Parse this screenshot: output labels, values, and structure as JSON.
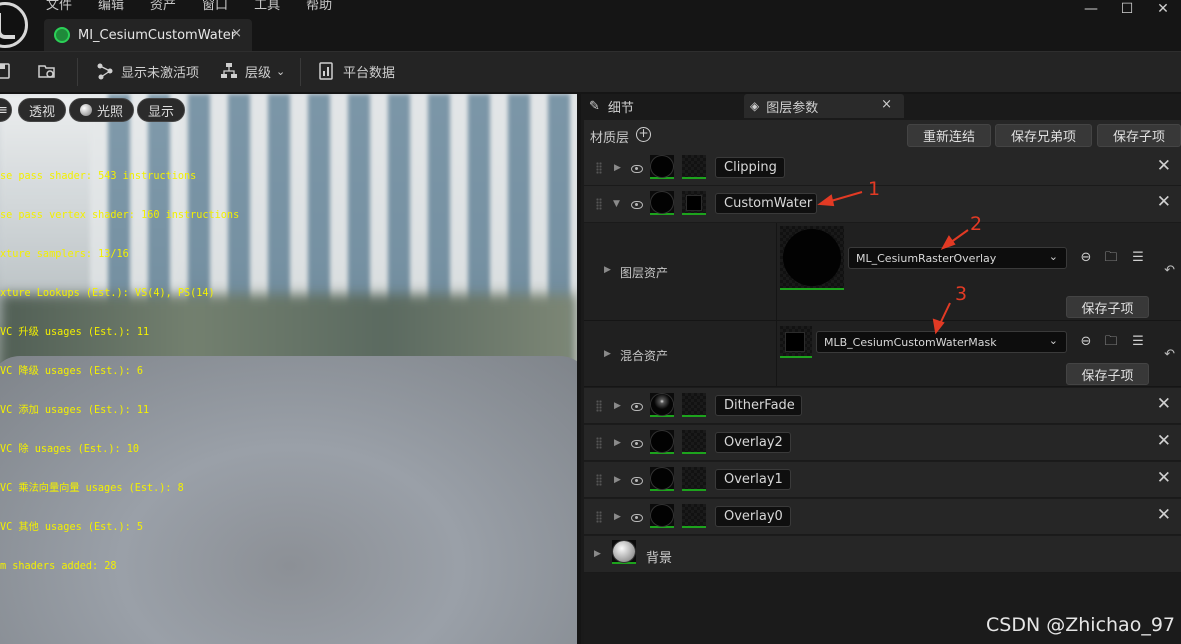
{
  "menu": [
    "文件",
    "编辑",
    "资产",
    "窗口",
    "工具",
    "帮助"
  ],
  "window_controls": [
    "—",
    "☐",
    "✕"
  ],
  "doc_tab": {
    "title": "MI_CesiumCustomWater",
    "close": "×"
  },
  "toolbar": {
    "show_inactive": "显示未激活项",
    "hierarchy": "层级",
    "platform_stats": "平台数据"
  },
  "viewport": {
    "perspective": "透视",
    "lighting": "光照",
    "show": "显示",
    "stats": [
      "se pass shader: 543 instructions",
      "se pass vertex shader: 160 instructions",
      "xture samplers: 13/16",
      "xture Lookups (Est.): VS(4), PS(14)",
      "VC 升级 usages (Est.): 11",
      "VC 降级 usages (Est.): 6",
      "VC 添加 usages (Est.): 11",
      "VC 除 usages (Est.): 10",
      "VC 乘法向量向量 usages (Est.): 8",
      "VC 其他 usages (Est.): 5",
      "m shaders added: 28"
    ]
  },
  "panel": {
    "tab_details": "细节",
    "tab_layer_params": "图层参数",
    "tab_close": "×",
    "material_layers_label": "材质层",
    "btn_relink": "重新连结",
    "btn_save_sibling": "保存兄弟项",
    "btn_save_child": "保存子项",
    "layers": [
      {
        "name": "Clipping"
      },
      {
        "name": "CustomWater"
      },
      {
        "name": "DitherFade"
      },
      {
        "name": "Overlay2"
      },
      {
        "name": "Overlay1"
      },
      {
        "name": "Overlay0"
      }
    ],
    "layer_asset_label": "图层资产",
    "layer_asset_value": "ML_CesiumRasterOverlay",
    "blend_asset_label": "混合资产",
    "blend_asset_value": "MLB_CesiumCustomWaterMask",
    "save_child": "保存子项",
    "background_label": "背景"
  },
  "annotations": [
    "1",
    "2",
    "3"
  ],
  "annotation_color": "#e23a24",
  "watermark": "CSDN @Zhichao_97"
}
